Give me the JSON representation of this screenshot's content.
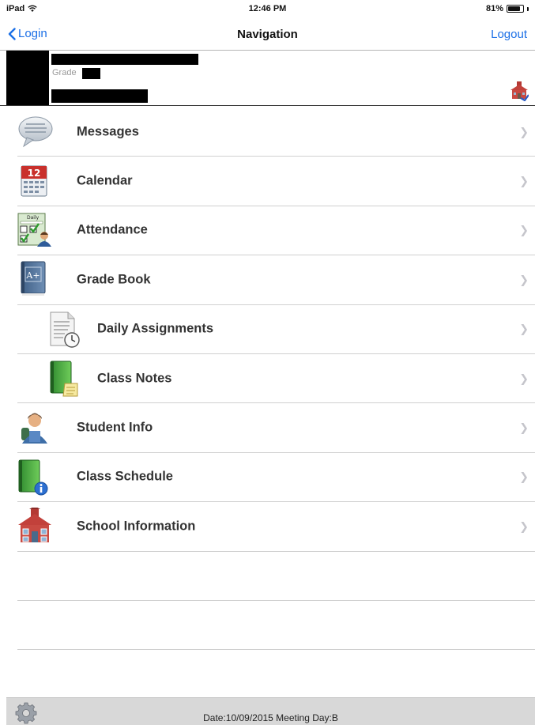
{
  "status_bar": {
    "device": "iPad",
    "time": "12:46 PM",
    "battery": "81%",
    "battery_level": 0.81
  },
  "nav": {
    "back_label": "Login",
    "title": "Navigation",
    "right_label": "Logout"
  },
  "student": {
    "grade_label": "Grade"
  },
  "menu": [
    {
      "label": "Messages",
      "icon": "speech-bubble-icon",
      "indent": false
    },
    {
      "label": "Calendar",
      "icon": "calendar-icon",
      "indent": false,
      "icon_text": "12"
    },
    {
      "label": "Attendance",
      "icon": "attendance-checklist-icon",
      "indent": false,
      "icon_text": "Daily"
    },
    {
      "label": "Grade Book",
      "icon": "gradebook-icon",
      "indent": false,
      "icon_text": "A+"
    },
    {
      "label": "Daily Assignments",
      "icon": "assignment-clock-icon",
      "indent": true
    },
    {
      "label": "Class Notes",
      "icon": "notebook-icon",
      "indent": true
    },
    {
      "label": "Student Info",
      "icon": "student-icon",
      "indent": false
    },
    {
      "label": "Class Schedule",
      "icon": "schedule-book-icon",
      "indent": false
    },
    {
      "label": "School Information",
      "icon": "schoolhouse-icon",
      "indent": false
    }
  ],
  "footer": {
    "text": "Date:10/09/2015 Meeting Day:B"
  },
  "colors": {
    "accent": "#1b6fe6",
    "chevron": "#c5c5cb",
    "footer_bg": "#d8d8d8"
  }
}
